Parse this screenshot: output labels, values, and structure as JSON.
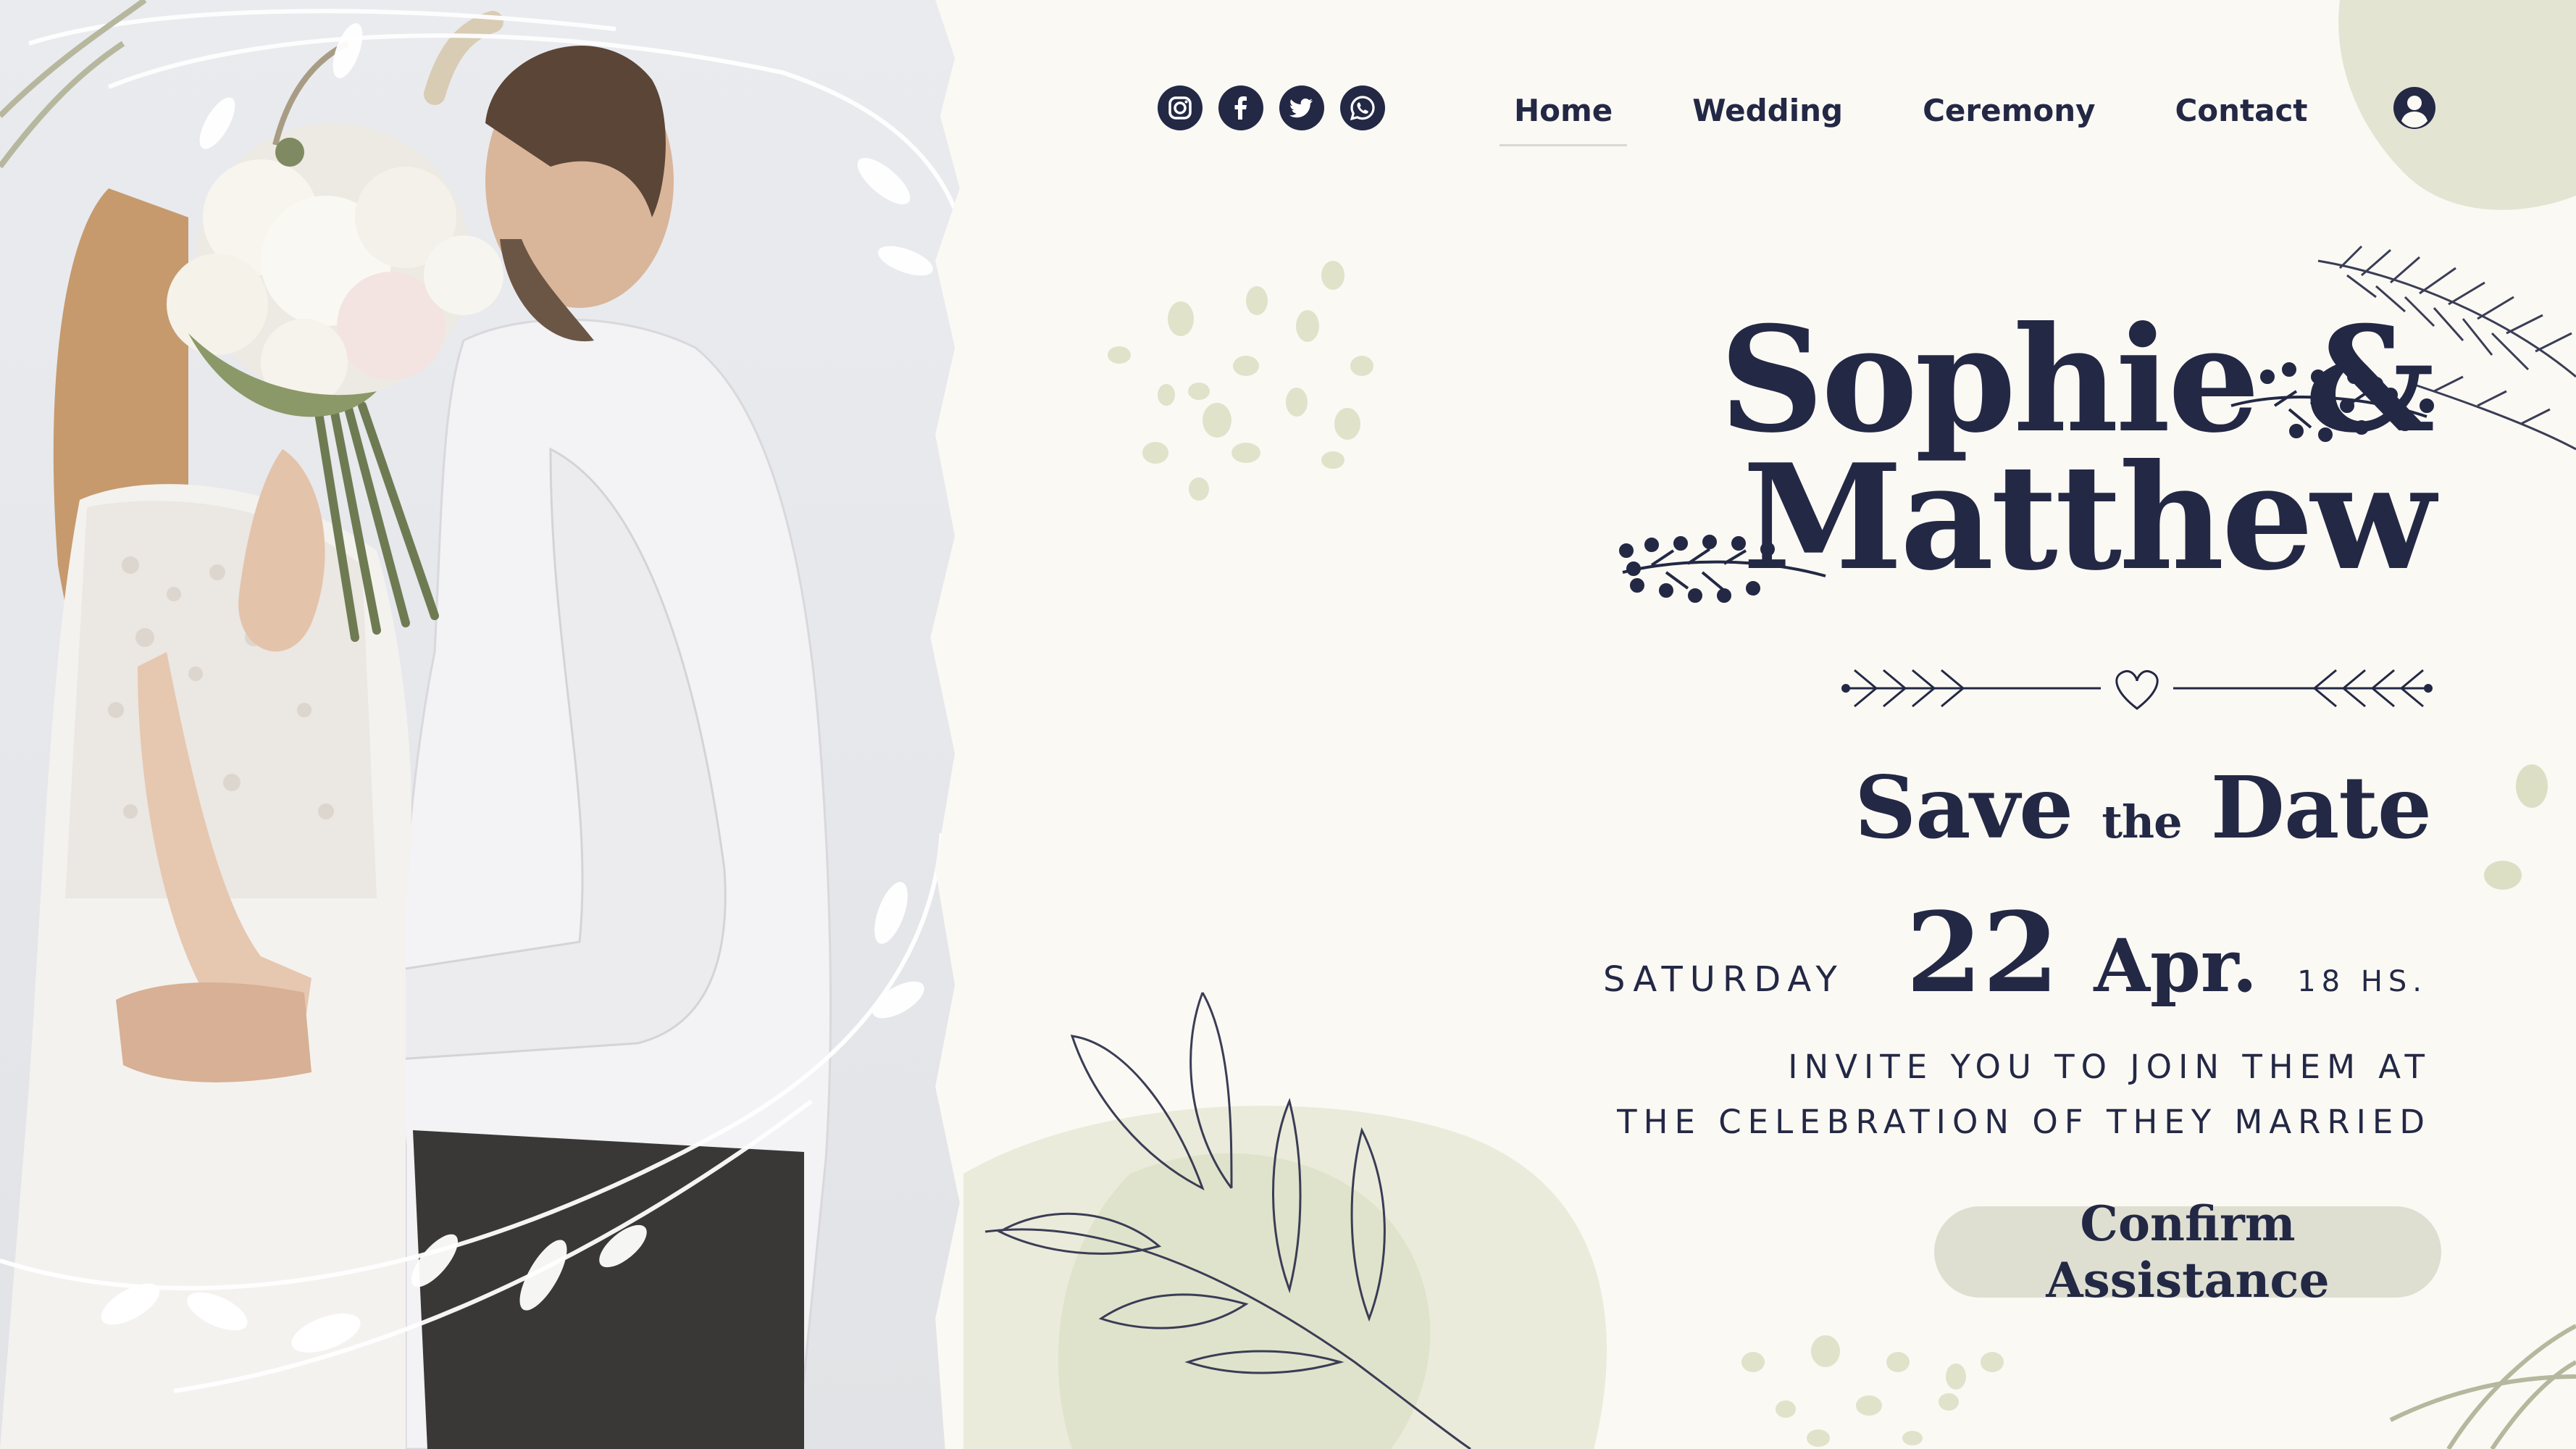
{
  "nav": {
    "items": [
      {
        "label": "Home",
        "active": true
      },
      {
        "label": "Wedding",
        "active": false
      },
      {
        "label": "Ceremony",
        "active": false
      },
      {
        "label": "Contact",
        "active": false
      }
    ]
  },
  "social": [
    "instagram-icon",
    "facebook-icon",
    "twitter-icon",
    "whatsapp-icon"
  ],
  "hero": {
    "name_line1": "Sophie &",
    "name_line2": "Matthew",
    "save_word1": "Save",
    "save_small": "the",
    "save_word2": "Date",
    "weekday": "SATURDAY",
    "day": "22",
    "month": "Apr.",
    "time": "18 HS.",
    "invite_line1": "INVITE YOU TO JOIN THEM AT",
    "invite_line2": "THE CELEBRATION OF THEY MARRIED",
    "cta_label": "Confirm Assistance"
  },
  "colors": {
    "navy": "#232845",
    "background": "#fbf9f4",
    "sage": "#dedfd1",
    "sage_dots": "#dfe0c8"
  }
}
